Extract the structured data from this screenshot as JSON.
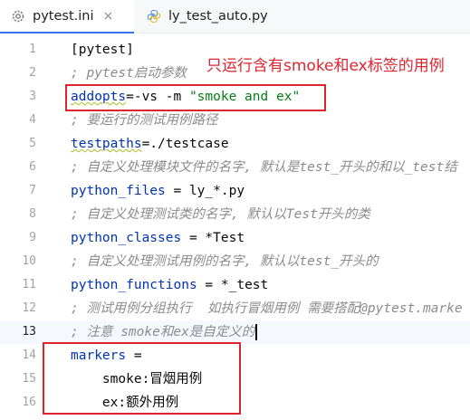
{
  "tabs": [
    {
      "label": "pytest.ini",
      "close": "×",
      "icon": "settings-file-icon",
      "active": true
    },
    {
      "label": "ly_test_auto.py",
      "icon": "python-file-icon",
      "active": false
    }
  ],
  "colors": {
    "comment": "#8c8c8c",
    "key": "#0033b3",
    "string": "#067d17",
    "annotation": "#e0242f"
  },
  "annotation": "只运行含有smoke和ex标签的用例",
  "lines": [
    {
      "num": "1",
      "text": "[pytest]"
    },
    {
      "num": "2",
      "comment": "; pytest启动参数"
    },
    {
      "num": "3",
      "key": "addopts",
      "rest": "=-vs -m ",
      "string": "\"smoke and ex\""
    },
    {
      "num": "4",
      "comment": "; 要运行的测试用例路径"
    },
    {
      "num": "5",
      "key": "testpaths",
      "rest": "=./testcase"
    },
    {
      "num": "6",
      "comment": "; 自定义处理模块文件的名字, 默认是test_开头的和以_test结"
    },
    {
      "num": "7",
      "key": "python_files",
      "rest": " = ly_*.py"
    },
    {
      "num": "8",
      "comment": "; 自定义处理测试类的名字, 默认以Test开头的类"
    },
    {
      "num": "9",
      "key": "python_classes",
      "rest": " = *Test"
    },
    {
      "num": "10",
      "comment": "; 自定义处理测试用例的名字, 默认以test_开头的"
    },
    {
      "num": "11",
      "key": "python_functions",
      "rest": " = *_test"
    },
    {
      "num": "12",
      "comment": "; 测试用例分组执行  如执行冒烟用例 需要搭配@pytest.marke"
    },
    {
      "num": "13",
      "comment": "; 注意 smoke和ex是自定义的"
    },
    {
      "num": "14",
      "key": "markers",
      "rest": " ="
    },
    {
      "num": "15",
      "plain": "    smoke:冒烟用例"
    },
    {
      "num": "16",
      "plain": "    ex:额外用例"
    }
  ]
}
